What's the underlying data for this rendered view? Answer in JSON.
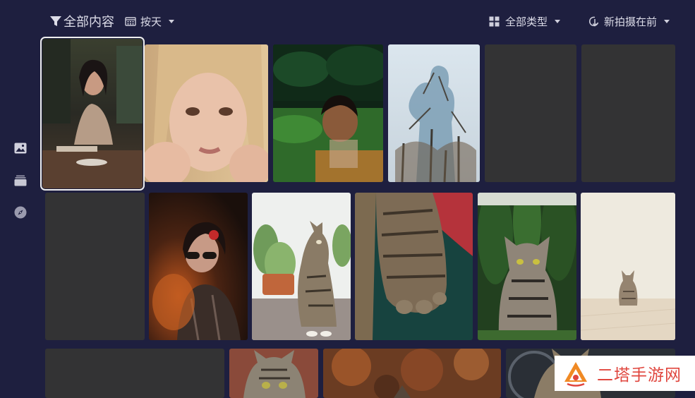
{
  "toolbar": {
    "filter_label": "全部内容",
    "date_label": "按天",
    "type_label": "全部类型",
    "sort_label": "新拍摄在前"
  },
  "sidebar": {
    "items": [
      {
        "name": "photos",
        "icon": "image-icon"
      },
      {
        "name": "albums",
        "icon": "stack-icon"
      },
      {
        "name": "explore",
        "icon": "compass-icon"
      }
    ]
  },
  "watermark": {
    "text": "二塔手游网"
  },
  "colors": {
    "background": "#1e1f3f",
    "placeholder": "#333334",
    "watermark_red": "#e0463e"
  }
}
